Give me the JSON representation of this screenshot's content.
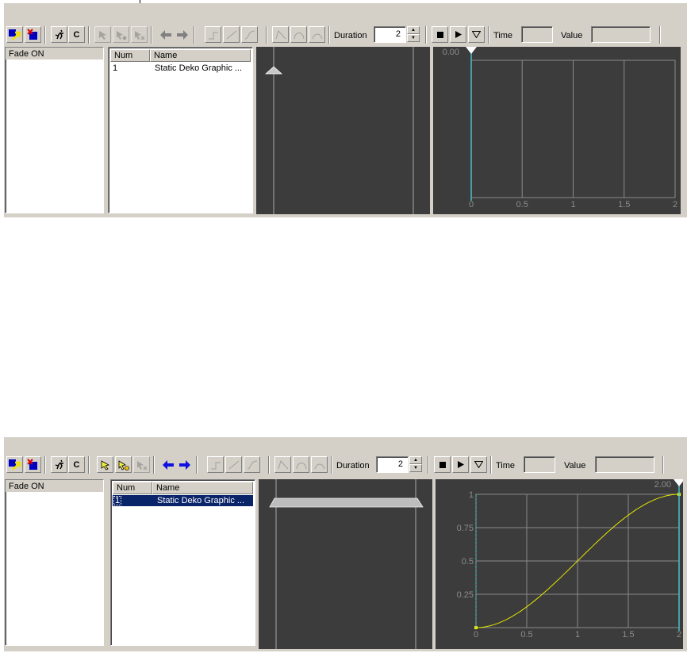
{
  "top_panel": {
    "toolbar": {
      "c_button": "C",
      "duration_label": "Duration",
      "duration_value": "2",
      "time_label": "Time",
      "time_value": "",
      "value_label": "Value",
      "value_value": ""
    },
    "tracks": {
      "header": "Fade ON"
    },
    "list": {
      "columns": [
        "Num",
        "Name"
      ],
      "rows": [
        {
          "num": "1",
          "name": "Static Deko Graphic ...",
          "selected": false
        }
      ]
    },
    "graph": {
      "time_readout": "0.00",
      "x_ticks": [
        "0",
        "0.5",
        "1",
        "1.5",
        "2"
      ],
      "y_ticks": []
    }
  },
  "bottom_panel": {
    "toolbar": {
      "c_button": "C",
      "duration_label": "Duration",
      "duration_value": "2",
      "time_label": "Time",
      "time_value": "",
      "value_label": "Value",
      "value_value": ""
    },
    "tracks": {
      "header": "Fade ON"
    },
    "list": {
      "columns": [
        "Num",
        "Name"
      ],
      "rows": [
        {
          "num": "1",
          "name": "Static Deko Graphic ...",
          "selected": true
        }
      ]
    },
    "graph": {
      "time_readout": "2.00",
      "x_ticks": [
        "0",
        "0.5",
        "1",
        "1.5",
        "2"
      ],
      "y_ticks": [
        "1",
        "0.75",
        "0.5",
        "0.25"
      ],
      "curve": {
        "type": "ease-in-out",
        "x": [
          0,
          2
        ],
        "y": [
          0,
          1
        ],
        "color": "#e6e600"
      }
    }
  },
  "colors": {
    "panel_bg": "#d4d0c8",
    "graph_bg": "#3c3c3c",
    "playhead": "#47c2c8",
    "selection": "#0a246a"
  }
}
